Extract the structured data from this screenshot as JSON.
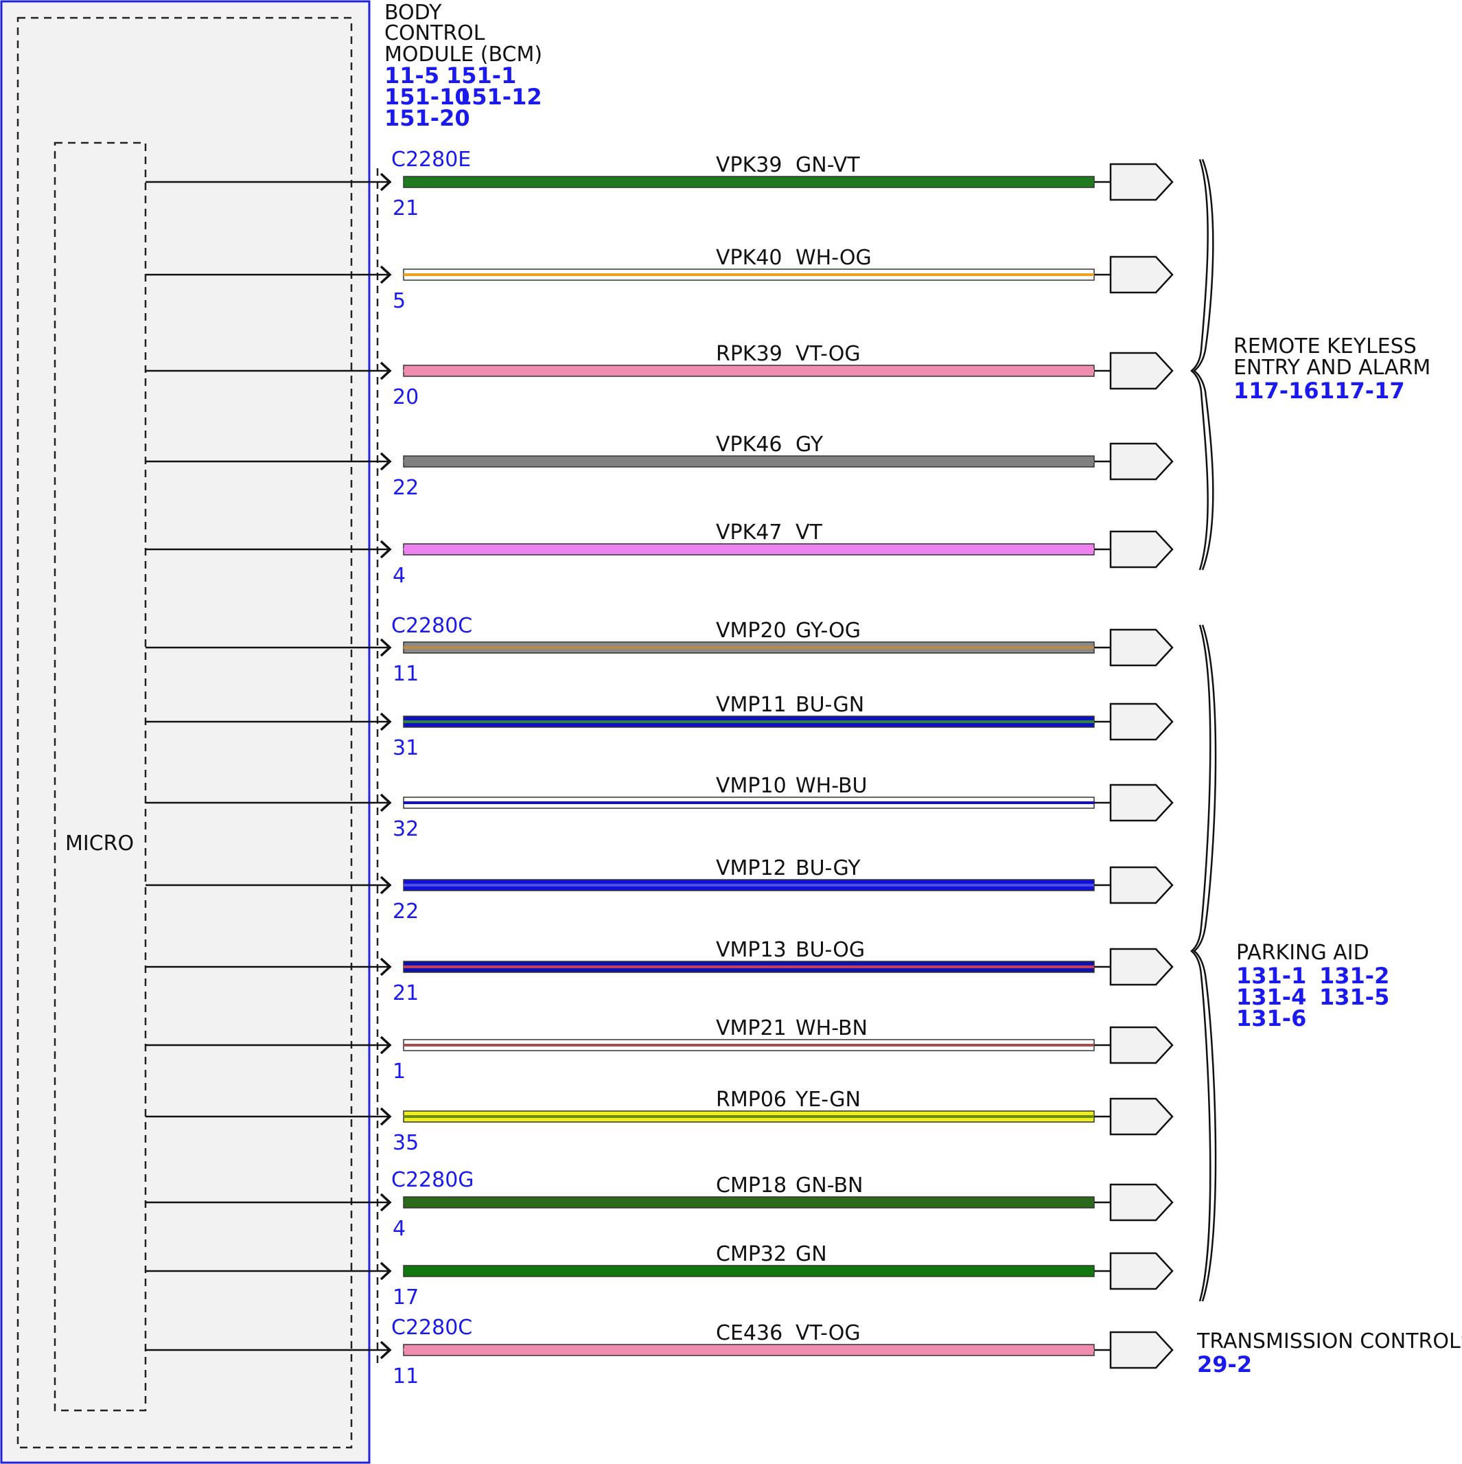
{
  "module": {
    "title_lines": [
      "BODY",
      "CONTROL",
      "MODULE (BCM)"
    ],
    "refs": [
      "11-5",
      "151-1",
      "151-10",
      "151-12",
      "151-20"
    ],
    "micro_label": "MICRO"
  },
  "connector_labels": [
    "C2280E",
    "C2280C",
    "C2280G",
    "C2280C"
  ],
  "wires": [
    {
      "circuit": "VPK39",
      "color": "GN-VT",
      "pin": "21",
      "fill": "#1f7a1f",
      "stripe": "#1f7a1f"
    },
    {
      "circuit": "VPK40",
      "color": "WH-OG",
      "pin": "5",
      "fill": "#ffffff",
      "stripe": "#f0a020"
    },
    {
      "circuit": "RPK39",
      "color": "VT-OG",
      "pin": "20",
      "fill": "#f08cb0",
      "stripe": "#f08cb0"
    },
    {
      "circuit": "VPK46",
      "color": "GY",
      "pin": "22",
      "fill": "#808080",
      "stripe": "#808080"
    },
    {
      "circuit": "VPK47",
      "color": "VT",
      "pin": "4",
      "fill": "#ee82ee",
      "stripe": "#ee82ee"
    },
    {
      "circuit": "VMP20",
      "color": "GY-OG",
      "pin": "11",
      "fill": "#8a8a8a",
      "stripe": "#c08840"
    },
    {
      "circuit": "VMP11",
      "color": "BU-GN",
      "pin": "31",
      "fill": "#1010cc",
      "stripe": "#2a8a2a"
    },
    {
      "circuit": "VMP10",
      "color": "WH-BU",
      "pin": "32",
      "fill": "#ffffff",
      "stripe": "#1010cc"
    },
    {
      "circuit": "VMP12",
      "color": "BU-GY",
      "pin": "22",
      "fill": "#1010dd",
      "stripe": "#5050e0"
    },
    {
      "circuit": "VMP13",
      "color": "BU-OG",
      "pin": "21",
      "fill": "#1010aa",
      "stripe": "#c04060"
    },
    {
      "circuit": "VMP21",
      "color": "WH-BN",
      "pin": "1",
      "fill": "#ffffff",
      "stripe": "#a05050"
    },
    {
      "circuit": "RMP06",
      "color": "YE-GN",
      "pin": "35",
      "fill": "#eeee20",
      "stripe": "#6a8a10"
    },
    {
      "circuit": "CMP18",
      "color": "GN-BN",
      "pin": "4",
      "fill": "#2a6a1a",
      "stripe": "#2a6a1a"
    },
    {
      "circuit": "CMP32",
      "color": "GN",
      "pin": "17",
      "fill": "#117711",
      "stripe": "#117711"
    },
    {
      "circuit": "CE436",
      "color": "VT-OG",
      "pin": "11",
      "fill": "#f08cb0",
      "stripe": "#f08cb0"
    }
  ],
  "destinations": [
    {
      "title_lines": [
        "REMOTE KEYLESS",
        "ENTRY AND ALARM"
      ],
      "refs": [
        "117-16",
        "117-17"
      ]
    },
    {
      "title_lines": [
        "PARKING AID"
      ],
      "refs": [
        "131-1",
        "131-2",
        "131-4",
        "131-5",
        "131-6"
      ]
    },
    {
      "title_lines": [
        "TRANSMISSION CONTROLS"
      ],
      "refs": [
        "29-2"
      ]
    }
  ]
}
